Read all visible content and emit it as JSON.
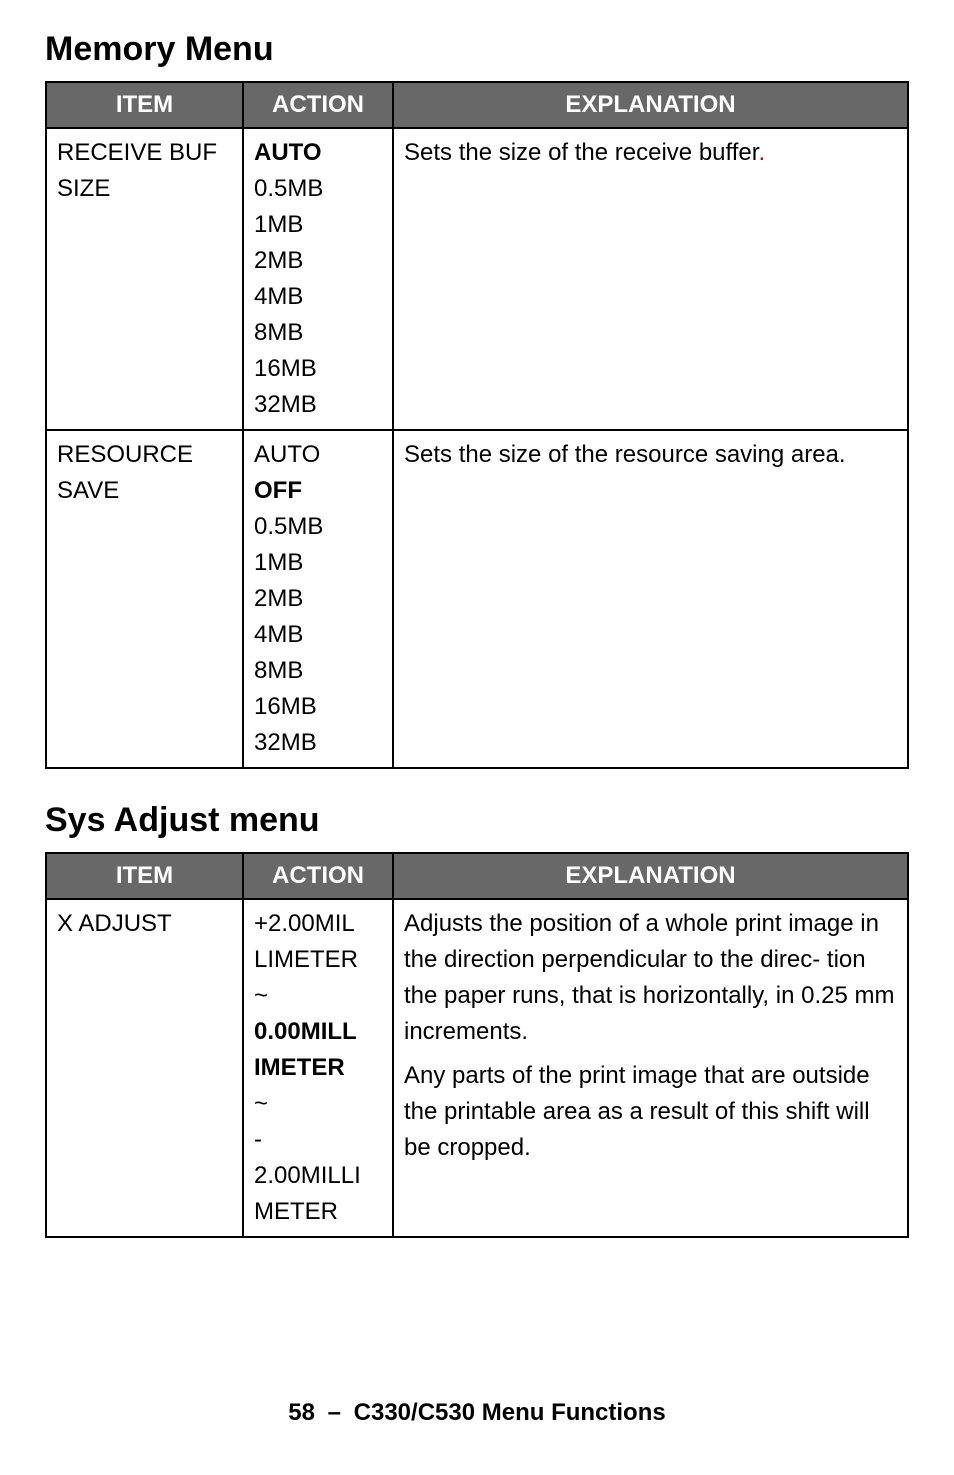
{
  "headings": {
    "memory_menu": "Memory Menu",
    "sys_adjust_menu": "Sys Adjust menu"
  },
  "table_headers": {
    "item": "ITEM",
    "action": "ACTION",
    "explanation": "EXPLANATION"
  },
  "memory_table": {
    "rows": [
      {
        "item": "RECEIVE BUF SIZE",
        "actions": [
          "AUTO",
          "0.5MB",
          "1MB",
          "2MB",
          "4MB",
          "8MB",
          "16MB",
          "32MB"
        ],
        "default_index": 0,
        "explanation": "Sets the size of the receive buffer",
        "trailing_dot": "."
      },
      {
        "item": "RESOURCE SAVE",
        "actions": [
          "AUTO",
          "OFF",
          "0.5MB",
          "1MB",
          "2MB",
          "4MB",
          "8MB",
          "16MB",
          "32MB"
        ],
        "default_index": 1,
        "explanation": "Sets the size of the resource saving area.",
        "trailing_dot": ""
      }
    ]
  },
  "sys_adjust_table": {
    "rows": [
      {
        "item": "X ADJUST",
        "action_lines": [
          "+2.00MIL",
          "LIMETER",
          "~",
          "0.00MILL",
          "IMETER",
          "~",
          "-",
          "2.00MILLI",
          "METER"
        ],
        "action_bold_indices": [
          3,
          4
        ],
        "explanation_paras": [
          "Adjusts the position of a whole print image in the direction perpendicular to the direc- tion the paper runs, that is horizontally, in 0.25 mm increments.",
          "Any parts of the print image that are outside the printable area as a result of this shift will be cropped."
        ]
      }
    ]
  },
  "footer": {
    "page": "58",
    "sep": "–",
    "title": "C330/C530 Menu Functions"
  }
}
